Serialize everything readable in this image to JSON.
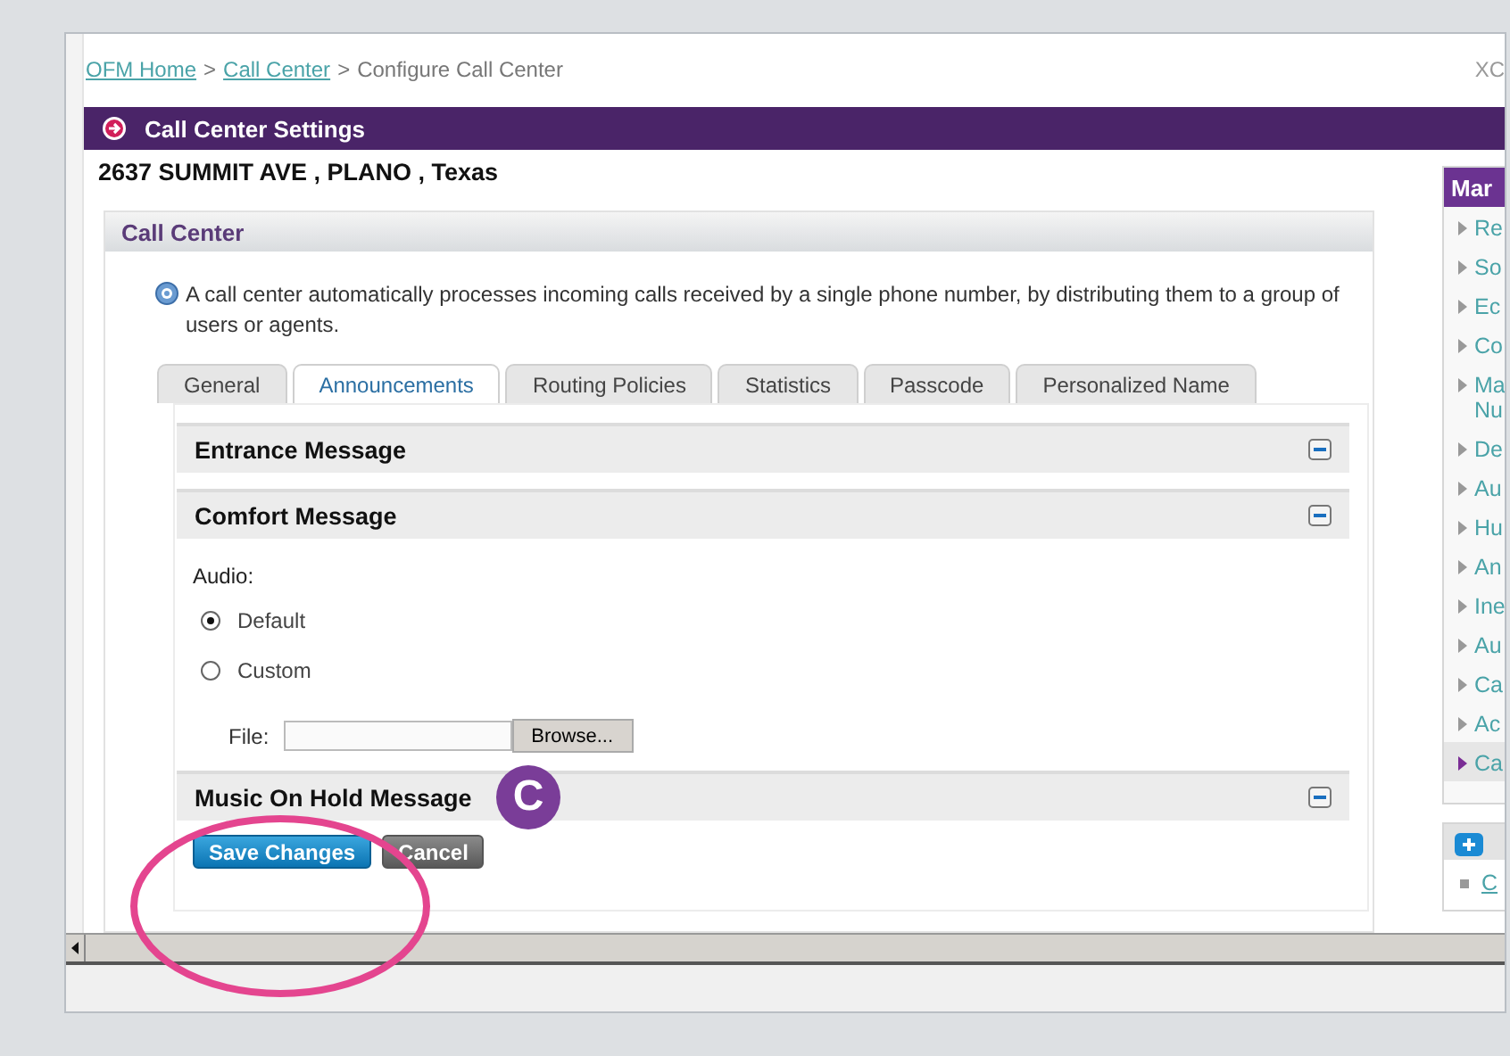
{
  "breadcrumb": [
    {
      "kind": "link",
      "text": "OFM Home"
    },
    {
      "kind": "separator",
      "text": ">"
    },
    {
      "kind": "link",
      "text": "Call Center"
    },
    {
      "kind": "separator",
      "text": ">"
    },
    {
      "kind": "current",
      "text": "Configure Call Center"
    }
  ],
  "top_right_text": "XC",
  "settings_bar": {
    "title": "Call Center Settings"
  },
  "address": "2637 SUMMIT AVE , PLANO , Texas",
  "panel": {
    "title": "Call Center",
    "info": "A call center automatically processes incoming calls received by a single phone number, by distributing them to a group of users or agents.",
    "tabs": [
      {
        "label": "General",
        "selected": false
      },
      {
        "label": "Announcements",
        "selected": true
      },
      {
        "label": "Routing Policies",
        "selected": false
      },
      {
        "label": "Statistics",
        "selected": false
      },
      {
        "label": "Passcode",
        "selected": false
      },
      {
        "label": "Personalized Name",
        "selected": false
      }
    ],
    "sections": [
      {
        "title": "Entrance Message"
      },
      {
        "title": "Comfort Message",
        "audio": {
          "label": "Audio:",
          "options": [
            {
              "label": "Default",
              "selected": true
            },
            {
              "label": "Custom",
              "selected": false
            }
          ]
        },
        "file": {
          "label": "File:",
          "button": "Browse..."
        }
      },
      {
        "title": "Music On Hold Message"
      }
    ],
    "buttons": [
      {
        "kind": "primary",
        "label": "Save Changes"
      },
      {
        "kind": "secondary",
        "label": "Cancel"
      }
    ]
  },
  "sidebar": {
    "title": "Mar",
    "items": [
      {
        "text": "Re",
        "selected": false
      },
      {
        "text": "So",
        "selected": false
      },
      {
        "text": "Ec",
        "selected": false
      },
      {
        "text": "Co",
        "selected": false
      },
      {
        "text": "Ma Nu",
        "selected": false
      },
      {
        "text": "De",
        "selected": false
      },
      {
        "text": "Au",
        "selected": false
      },
      {
        "text": "Hu",
        "selected": false
      },
      {
        "text": "An",
        "selected": false
      },
      {
        "text": "Ine",
        "selected": false
      },
      {
        "text": "Au",
        "selected": false
      },
      {
        "text": "Ca",
        "selected": false
      },
      {
        "text": "Ac",
        "selected": false
      },
      {
        "text": "Ca",
        "selected": true
      }
    ],
    "links": [
      {
        "text": "C"
      }
    ]
  },
  "annotation": {
    "badge": "C"
  }
}
